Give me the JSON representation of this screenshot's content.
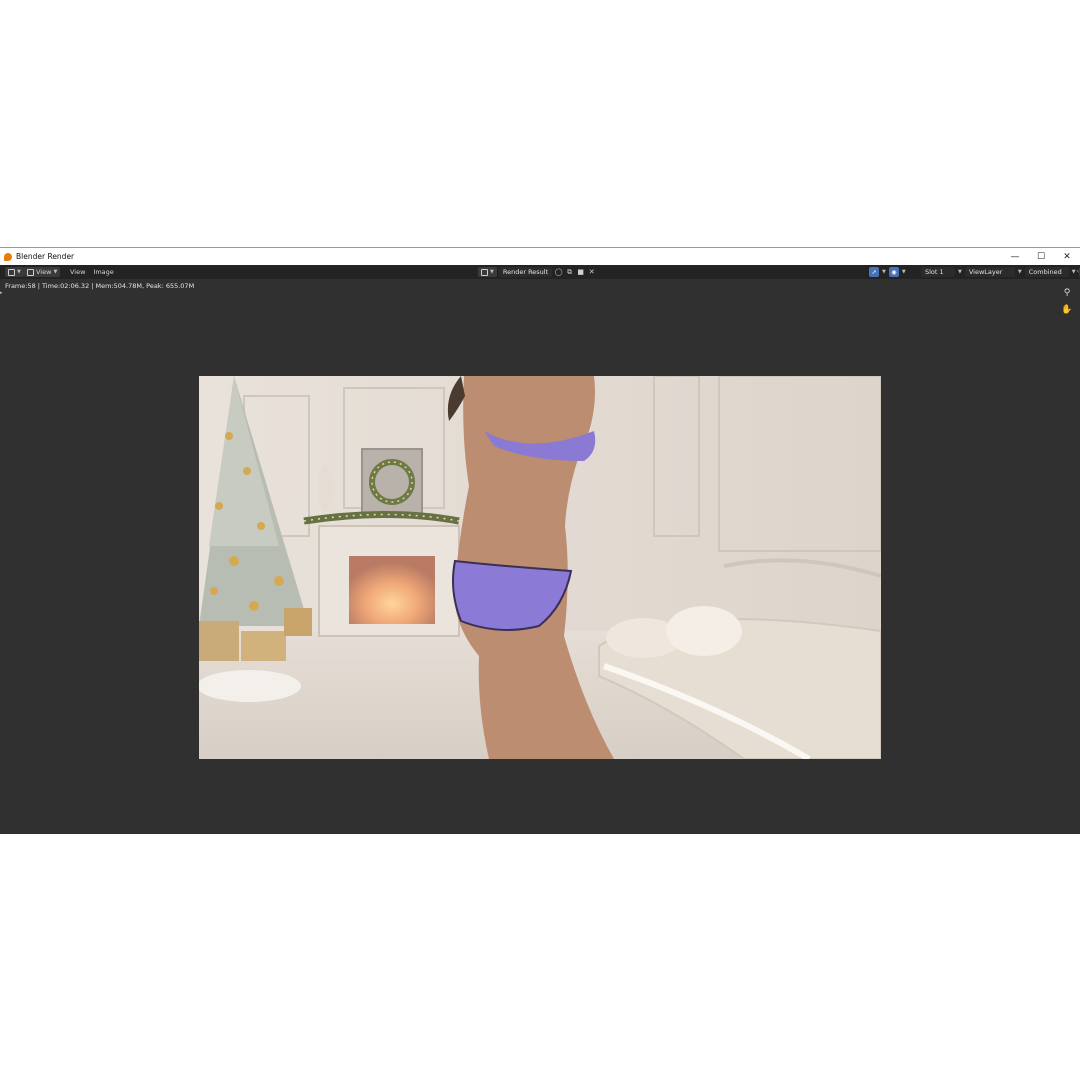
{
  "window": {
    "title": "Blender Render"
  },
  "header": {
    "menus": [
      "View",
      "View",
      "Image"
    ],
    "image_name": "Render Result",
    "slot": "Slot 1",
    "view_layer": "ViewLayer",
    "pass": "Combined"
  },
  "status": {
    "text": "Frame:58 | Time:02:06.32 | Mem:504.78M, Peak: 655.07M"
  },
  "icons": {
    "app": "blender-logo-icon",
    "editor_type": "image-editor-icon",
    "zoom": "zoom-icon",
    "pan": "hand-icon"
  },
  "colors": {
    "accent": "#4772b3",
    "editor_bg": "#303030",
    "header_bg": "#232323"
  }
}
